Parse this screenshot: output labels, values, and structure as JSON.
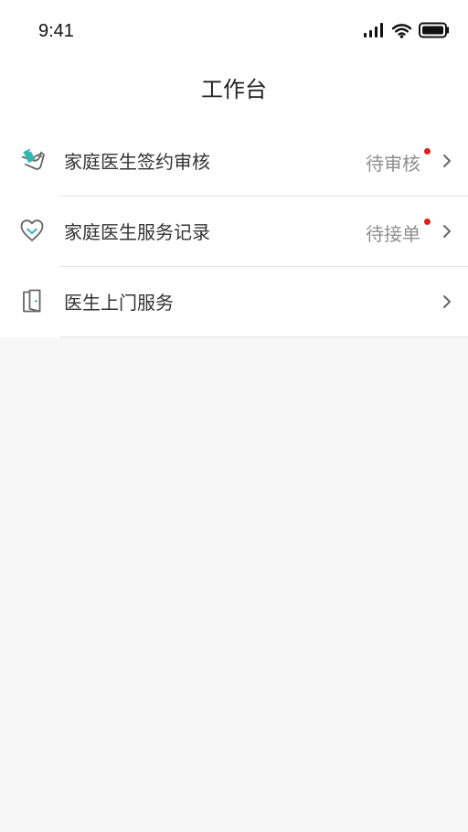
{
  "status_bar": {
    "time": "9:41",
    "icons": [
      "cellular-signal-icon",
      "wifi-icon",
      "battery-icon"
    ]
  },
  "header": {
    "title": "工作台"
  },
  "items": [
    {
      "label": "家庭医生签约审核",
      "status": "待审核",
      "icon": "signing-hand-icon",
      "badge": true
    },
    {
      "label": "家庭医生服务记录",
      "status": "待接单",
      "icon": "heart-icon",
      "badge": true
    },
    {
      "label": "医生上门服务",
      "icon": "door-icon",
      "badge": false
    }
  ],
  "colors": {
    "accent": "#35b7b1",
    "badge": "#e0201c",
    "background": "#f7f7f7"
  }
}
